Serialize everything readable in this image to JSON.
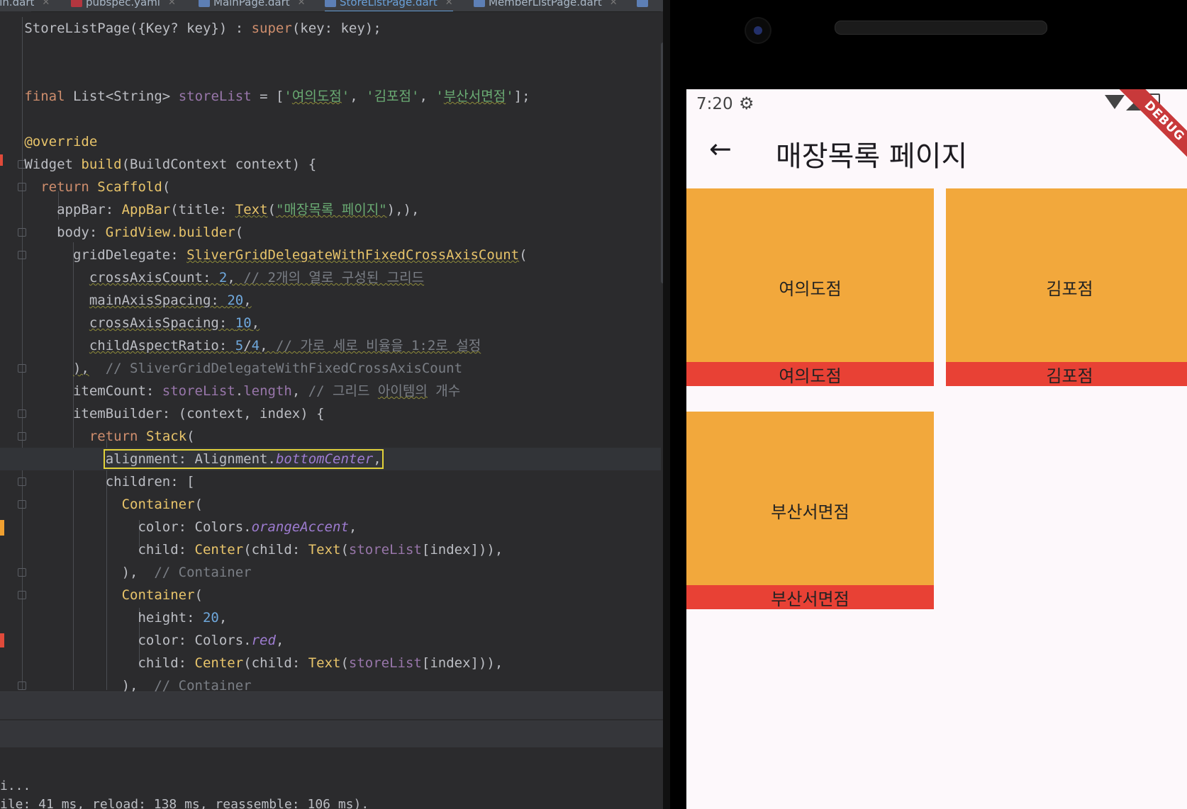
{
  "ide": {
    "tabs": [
      {
        "label": "ain.dart",
        "icon": "dart-file-icon"
      },
      {
        "label": "pubspec.yaml",
        "icon": "yaml-file-icon"
      },
      {
        "label": "MainPage.dart",
        "icon": "dart-file-icon"
      },
      {
        "label": "StoreListPage.dart",
        "icon": "dart-file-icon",
        "active": true
      },
      {
        "label": "MemberListPage.dart",
        "icon": "dart-file-icon"
      }
    ],
    "console": {
      "line1": "i...",
      "line2": "ile: 41 ms, reload: 138 ms, reassemble: 106 ms)."
    }
  },
  "phone": {
    "status": {
      "time": "7:20",
      "debug_banner": "DEBUG"
    },
    "appbar": {
      "title": "매장목록 페이지"
    },
    "stores": [
      "여의도점",
      "김포점",
      "부산서면점"
    ],
    "colors": {
      "tile": "#f2a83c",
      "bar": "#e84135",
      "background": "#fdf8fb"
    }
  }
}
